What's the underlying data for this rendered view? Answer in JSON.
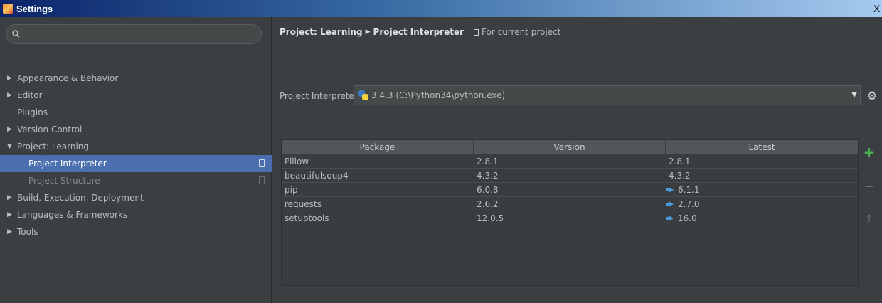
{
  "window": {
    "title": "Settings",
    "close_label": "X"
  },
  "sidebar": {
    "search_placeholder": "",
    "items": [
      {
        "label": "Appearance & Behavior"
      },
      {
        "label": "Editor"
      },
      {
        "label": "Plugins"
      },
      {
        "label": "Version Control"
      },
      {
        "label": "Project: Learning"
      },
      {
        "label": "Project Interpreter"
      },
      {
        "label": "Project Structure"
      },
      {
        "label": "Build, Execution, Deployment"
      },
      {
        "label": "Languages & Frameworks"
      },
      {
        "label": "Tools"
      }
    ]
  },
  "main": {
    "breadcrumb": {
      "part1": "Project: Learning",
      "part2": "Project Interpreter",
      "scope": "For current project"
    },
    "interpreter": {
      "label": "Project Interpreter:",
      "value": "3.4.3 (C:\\Python34\\python.exe)"
    },
    "table": {
      "headers": [
        "Package",
        "Version",
        "Latest"
      ],
      "rows": [
        {
          "package": "Pillow",
          "version": "2.8.1",
          "latest": "2.8.1",
          "upgrade": false
        },
        {
          "package": "beautifulsoup4",
          "version": "4.3.2",
          "latest": "4.3.2",
          "upgrade": false
        },
        {
          "package": "pip",
          "version": "6.0.8",
          "latest": "6.1.1",
          "upgrade": true
        },
        {
          "package": "requests",
          "version": "2.6.2",
          "latest": "2.7.0",
          "upgrade": true
        },
        {
          "package": "setuptools",
          "version": "12.0.5",
          "latest": "16.0",
          "upgrade": true
        }
      ]
    },
    "tools": {
      "add": "+",
      "remove": "−",
      "upgrade": "↑"
    }
  },
  "colors": {
    "selection": "#4b6eaf",
    "add_green": "#4caf50",
    "upgrade_blue": "#4a9be0"
  }
}
